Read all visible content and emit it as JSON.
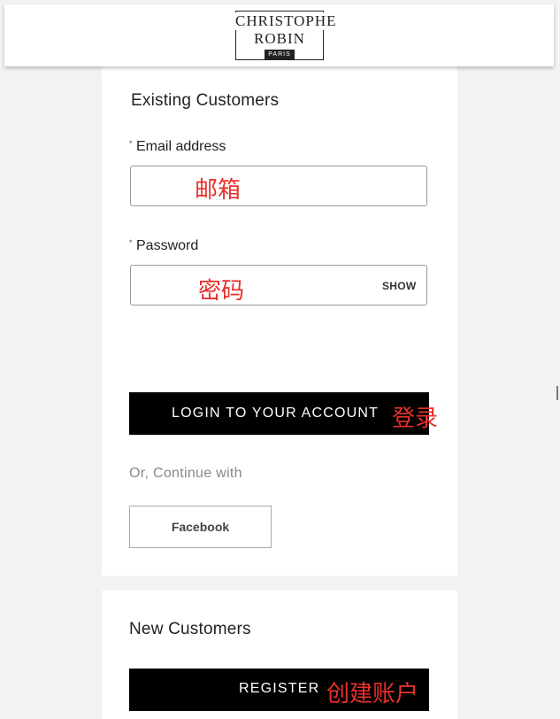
{
  "header": {
    "logo_line1": "CHRISTOPHE",
    "logo_line2": "ROBIN",
    "logo_sub": "PARIS"
  },
  "login": {
    "title": "Existing Customers",
    "required_mark": "*",
    "email_label": "Email address",
    "email_annotation": "邮箱",
    "password_label": "Password",
    "password_annotation": "密码",
    "show_label": "SHOW",
    "login_button": "LOGIN TO YOUR ACCOUNT",
    "login_annotation": "登录",
    "continue_text": "Or, Continue with",
    "facebook_button": "Facebook"
  },
  "register": {
    "title": "New Customers",
    "register_button": "REGISTER",
    "register_annotation": "创建账户"
  },
  "colors": {
    "page_bg": "#f2f2f2",
    "card_bg": "#ffffff",
    "button_bg": "#000000",
    "annotation": "#e8302a"
  }
}
